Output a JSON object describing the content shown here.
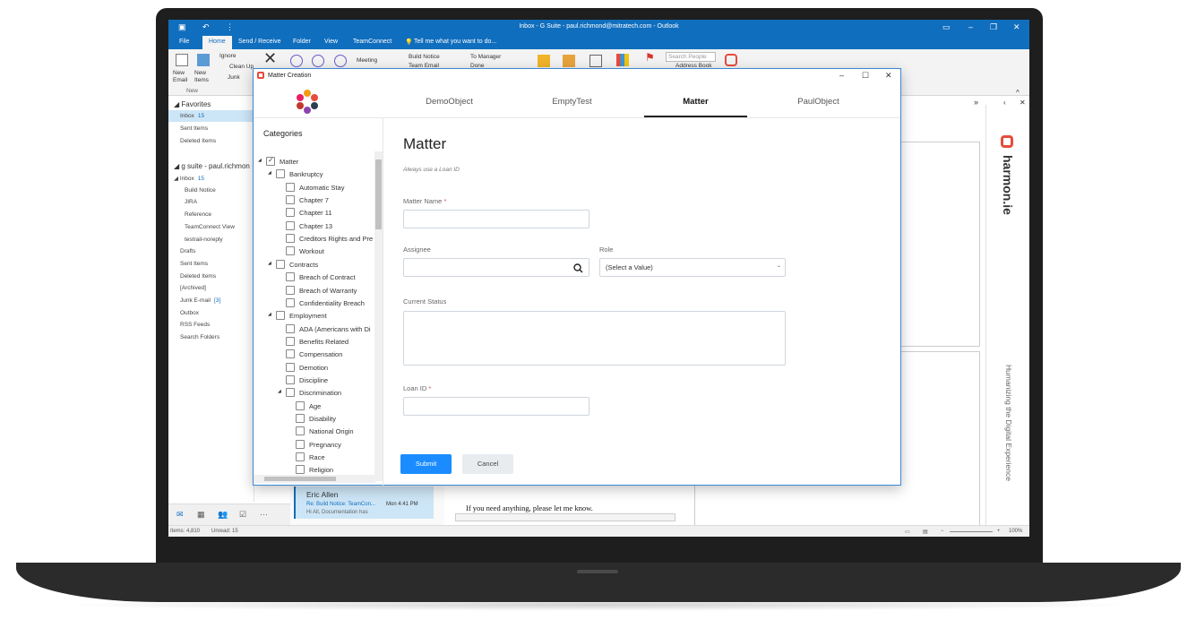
{
  "outlook": {
    "window_title": "Inbox - G Suite - paul.richmond@mitratech.com - Outlook",
    "tabs": [
      "File",
      "Home",
      "Send / Receive",
      "Folder",
      "View",
      "TeamConnect"
    ],
    "tell_me": "Tell me what you want to do...",
    "ribbon": {
      "new_email": "New Email",
      "new_items": "New Items",
      "group_new": "New",
      "ignore": "Ignore",
      "clean_up": "Clean Up",
      "junk": "Junk",
      "meeting": "Meeting",
      "build_notice": "Build Notice",
      "team_email": "Team Email",
      "to_manager": "To Manager",
      "done": "Done",
      "search_people": "Search People",
      "address_book": "Address Book"
    },
    "favorites_header": "Favorites",
    "favorites": [
      {
        "label": "Inbox",
        "count": "15"
      },
      {
        "label": "Sent Items",
        "count": ""
      },
      {
        "label": "Deleted Items",
        "count": ""
      }
    ],
    "account_header": "g suite - paul.richmon",
    "folders": [
      {
        "label": "Inbox",
        "count": "15",
        "sub": false
      },
      {
        "label": "Build Notice",
        "count": "",
        "sub": true
      },
      {
        "label": "JIRA",
        "count": "",
        "sub": true
      },
      {
        "label": "Reference",
        "count": "",
        "sub": true
      },
      {
        "label": "TeamConnect View",
        "count": "",
        "sub": true
      },
      {
        "label": "testrail-noreply",
        "count": "",
        "sub": true
      },
      {
        "label": "Drafts",
        "count": "",
        "sub": false
      },
      {
        "label": "Sent Items",
        "count": "",
        "sub": false
      },
      {
        "label": "Deleted Items",
        "count": "",
        "sub": false
      },
      {
        "label": "[Archived]",
        "count": "",
        "sub": false
      },
      {
        "label": "Junk E-mail",
        "count": "[3]",
        "sub": false
      },
      {
        "label": "Outbox",
        "count": "",
        "sub": false
      },
      {
        "label": "RSS Feeds",
        "count": "",
        "sub": false
      },
      {
        "label": "Search Folders",
        "count": "",
        "sub": false
      }
    ],
    "message": {
      "sender": "Eric Allen",
      "subject": "Re: Build Notice: TeamCon...",
      "time": "Mon 4:41 PM",
      "preview": "Hi All,  Documentation has"
    },
    "reading_text": "If you need anything, please let me know.",
    "status": {
      "items": "Items: 4,810",
      "unread": "Unread: 15",
      "zoom": "100%"
    },
    "harmonie": {
      "brand": "harmon.ie",
      "tagline": "Humanizing the Digital Experience"
    }
  },
  "dialog": {
    "title": "Matter Creation",
    "tabs": [
      {
        "label": "DemoObject",
        "active": false
      },
      {
        "label": "EmptyTest",
        "active": false
      },
      {
        "label": "Matter",
        "active": true
      },
      {
        "label": "PaulObject",
        "active": false
      }
    ],
    "categories_title": "Categories",
    "tree": [
      {
        "label": "Matter",
        "level": 0,
        "checked": true,
        "expanded": true
      },
      {
        "label": "Bankruptcy",
        "level": 1,
        "checked": false,
        "expanded": true
      },
      {
        "label": "Automatic Stay",
        "level": 2,
        "checked": false
      },
      {
        "label": "Chapter 7",
        "level": 2,
        "checked": false
      },
      {
        "label": "Chapter 11",
        "level": 2,
        "checked": false
      },
      {
        "label": "Chapter 13",
        "level": 2,
        "checked": false
      },
      {
        "label": "Creditors Rights and Pre",
        "level": 2,
        "checked": false
      },
      {
        "label": "Workout",
        "level": 2,
        "checked": false
      },
      {
        "label": "Contracts",
        "level": 1,
        "checked": false,
        "expanded": true
      },
      {
        "label": "Breach of Contract",
        "level": 2,
        "checked": false
      },
      {
        "label": "Breach of Warranty",
        "level": 2,
        "checked": false
      },
      {
        "label": "Confidentiality Breach",
        "level": 2,
        "checked": false
      },
      {
        "label": "Employment",
        "level": 1,
        "checked": false,
        "expanded": true
      },
      {
        "label": "ADA (Americans with Di",
        "level": 2,
        "checked": false
      },
      {
        "label": "Benefits Related",
        "level": 2,
        "checked": false
      },
      {
        "label": "Compensation",
        "level": 2,
        "checked": false
      },
      {
        "label": "Demotion",
        "level": 2,
        "checked": false
      },
      {
        "label": "Discipline",
        "level": 2,
        "checked": false
      },
      {
        "label": "Discrimination",
        "level": 2,
        "checked": false,
        "expanded": true
      },
      {
        "label": "Age",
        "level": 3,
        "checked": false
      },
      {
        "label": "Disability",
        "level": 3,
        "checked": false
      },
      {
        "label": "National Origin",
        "level": 3,
        "checked": false
      },
      {
        "label": "Pregnancy",
        "level": 3,
        "checked": false
      },
      {
        "label": "Race",
        "level": 3,
        "checked": false
      },
      {
        "label": "Religion",
        "level": 3,
        "checked": false
      }
    ],
    "form": {
      "title": "Matter",
      "subtitle": "Always use a Loan ID",
      "matter_name_label": "Matter Name",
      "assignee_label": "Assignee",
      "role_label": "Role",
      "role_value": "(Select a Value)",
      "current_status_label": "Current Status",
      "loan_id_label": "Loan ID",
      "required_mark": "*"
    },
    "submit_label": "Submit",
    "cancel_label": "Cancel"
  },
  "colors": {
    "outlook_blue": "#106ebe",
    "submit_blue": "#1a8cff",
    "dialog_border": "#3c88d4"
  }
}
